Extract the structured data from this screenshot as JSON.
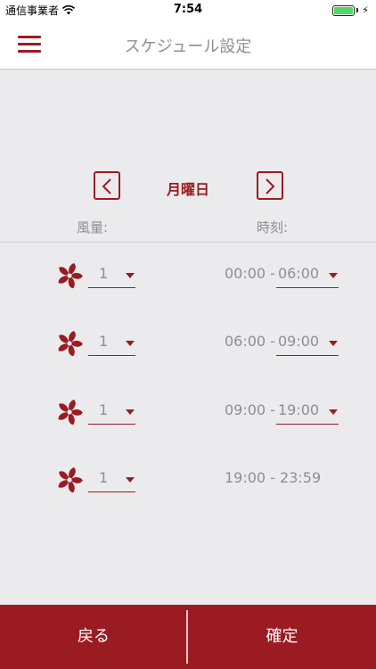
{
  "status_bar": {
    "carrier": "通信事業者",
    "time": "7:54",
    "wifi_icon": "wifi-icon",
    "battery_icon": "battery-icon",
    "charging_icon": "charging-bolt-icon",
    "battery_color": "#4cd964"
  },
  "navbar": {
    "title": "スケジュール設定",
    "menu_icon": "hamburger-menu-icon"
  },
  "day_selector": {
    "day": "月曜日",
    "prev_icon": "chevron-left-icon",
    "next_icon": "chevron-right-icon"
  },
  "headers": {
    "fan": "風量:",
    "time": "時刻:"
  },
  "schedule": [
    {
      "level": "1",
      "start": "00:00 -",
      "end": "06:00",
      "editable_end": true
    },
    {
      "level": "1",
      "start": "06:00 -",
      "end": "09:00",
      "editable_end": true
    },
    {
      "level": "1",
      "start": "09:00 -",
      "end": "19:00",
      "editable_end": true
    },
    {
      "level": "1",
      "static_time": "19:00 - 23:59",
      "editable_end": false
    }
  ],
  "bottom": {
    "back_label": "戻る",
    "confirm_label": "確定"
  },
  "colors": {
    "accent": "#9b1b22",
    "text_gray": "#8e8e93",
    "background": "#ebebed"
  }
}
